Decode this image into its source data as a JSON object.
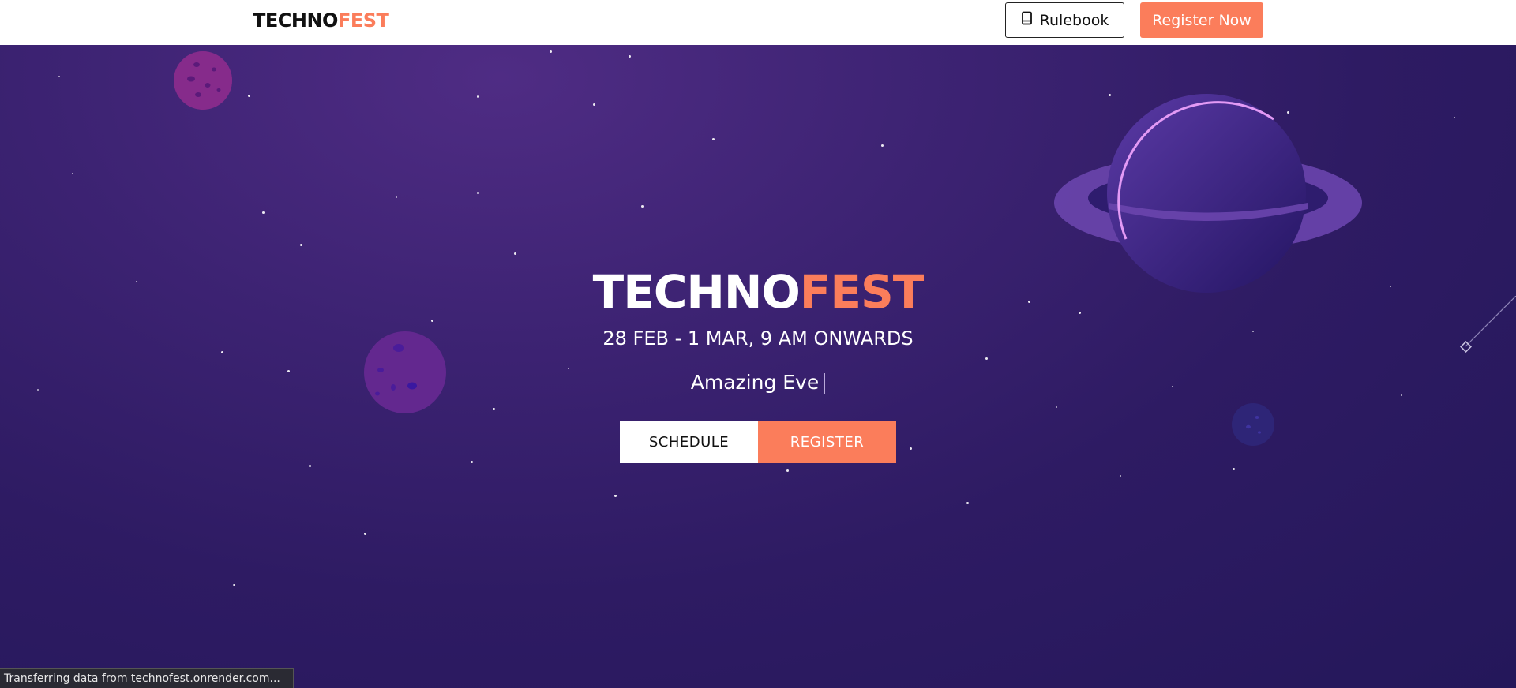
{
  "header": {
    "logo_part1": "TECHNO",
    "logo_part2": "FEST",
    "rulebook_label": "Rulebook",
    "rulebook_icon": "book-icon",
    "register_now_label": "Register Now"
  },
  "hero": {
    "title_part1": "TECHNO",
    "title_part2": "FEST",
    "dates": "28 FEB - 1 MAR, 9 AM ONWARDS",
    "typed_text": "Amazing Eve",
    "schedule_label": "SCHEDULE",
    "register_label": "REGISTER"
  },
  "status_bar": {
    "text": "Transferring data from technofest.onrender.com..."
  },
  "colors": {
    "accent": "#fb7d5b",
    "background": "#2e1b63",
    "header_bg": "#ffffff",
    "text_dark": "#111111"
  }
}
